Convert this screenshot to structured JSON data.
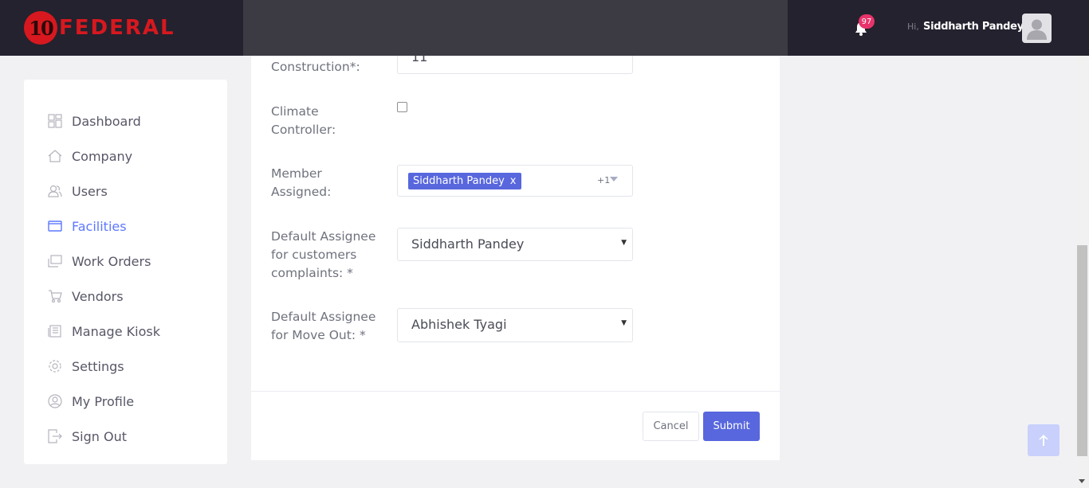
{
  "header": {
    "brand_number": "10",
    "brand_name": "FEDERAL",
    "notification_count": "97",
    "greeting": "Hi,",
    "user_name": "Siddharth Pandey"
  },
  "sidebar": {
    "items": [
      {
        "label": "Dashboard",
        "icon": "dashboard-icon"
      },
      {
        "label": "Company",
        "icon": "home-icon"
      },
      {
        "label": "Users",
        "icon": "users-icon"
      },
      {
        "label": "Facilities",
        "icon": "facilities-icon",
        "active": true
      },
      {
        "label": "Work Orders",
        "icon": "work-orders-icon"
      },
      {
        "label": "Vendors",
        "icon": "cart-icon"
      },
      {
        "label": "Manage Kiosk",
        "icon": "kiosk-icon"
      },
      {
        "label": "Settings",
        "icon": "gear-icon"
      },
      {
        "label": "My Profile",
        "icon": "profile-icon"
      },
      {
        "label": "Sign Out",
        "icon": "sign-out-icon"
      }
    ]
  },
  "form": {
    "construction_label": "Construction*:",
    "construction_value": "11",
    "climate_label": "Climate Controller:",
    "climate_checked": false,
    "member_label": "Member Assigned:",
    "member_tag": "Siddharth Pandey",
    "member_tag_remove": "x",
    "member_more": "+1",
    "complaints_label": "Default Assignee for customers complaints: *",
    "complaints_value": "Siddharth Pandey",
    "moveout_label": "Default Assignee for Move Out: *",
    "moveout_value": "Abhishek Tyagi"
  },
  "footer": {
    "cancel_label": "Cancel",
    "submit_label": "Submit"
  },
  "colors": {
    "accent": "#5867dd",
    "active_nav": "#5d78ff",
    "brand_red": "#d7181f",
    "badge": "#e8336b"
  }
}
